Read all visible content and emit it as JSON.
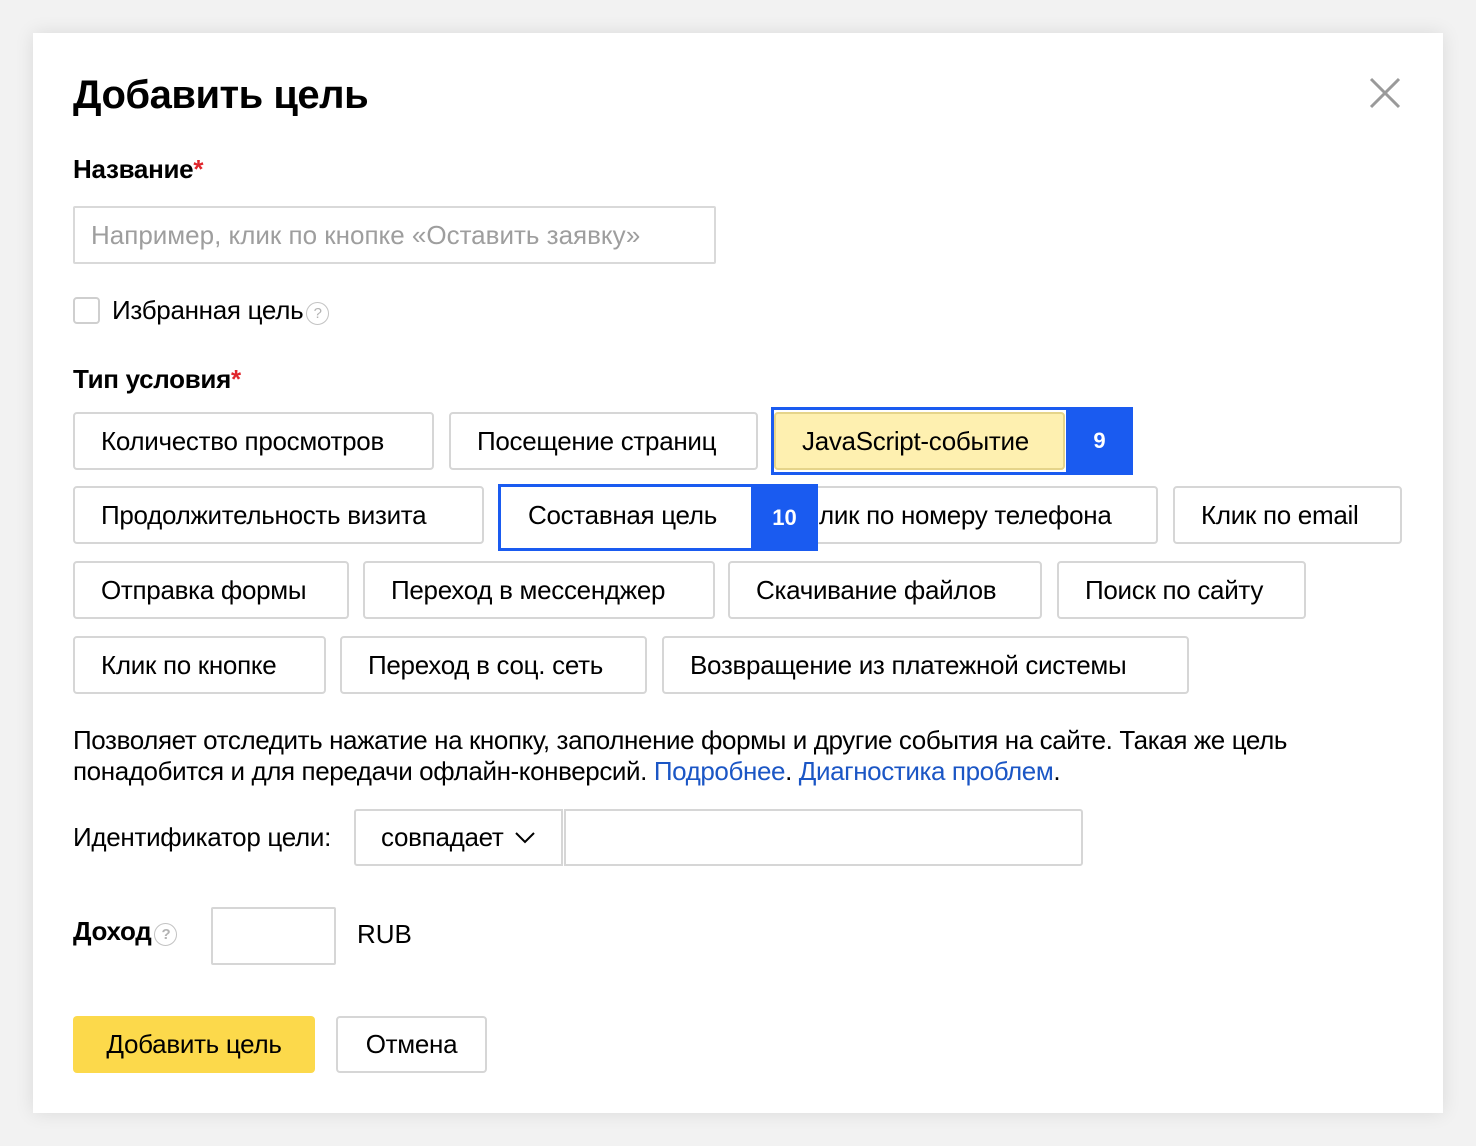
{
  "dialog": {
    "title": "Добавить цель",
    "close_icon": "close-icon"
  },
  "name_field": {
    "label": "Название",
    "required_mark": "*",
    "placeholder": "Например, клик по кнопке «Оставить заявку»",
    "value": ""
  },
  "favorite": {
    "label": "Избранная цель",
    "help_glyph": "?"
  },
  "condition_type": {
    "label": "Тип условия",
    "required_mark": "*",
    "options": [
      "Количество просмотров",
      "Посещение страниц",
      "JavaScript-событие",
      "Продолжительность визита",
      "Составная цель",
      "Клик по номеру телефона",
      "Клик по email",
      "Отправка формы",
      "Переход в мессенджер",
      "Скачивание файлов",
      "Поиск по сайту",
      "Клик по кнопке",
      "Переход в соц. сеть",
      "Возвращение из платежной системы"
    ],
    "visible_label_clik_phone": "лик по номеру телефона",
    "selected": "JavaScript-событие"
  },
  "annotations": [
    {
      "label": "9"
    },
    {
      "label": "10"
    }
  ],
  "description": {
    "text": "Позволяет отследить нажатие на кнопку, заполнение формы и другие события на сайте. Такая же цель понадобится и для передачи офлайн-конверсий. ",
    "link_more": "Подробнее",
    "sep": ". ",
    "link_diag": "Диагностика проблем",
    "end": "."
  },
  "goal_id": {
    "label": "Идентификатор цели:",
    "operator": "совпадает",
    "value": ""
  },
  "income": {
    "label": "Доход",
    "help_glyph": "?",
    "value": "",
    "currency": "RUB"
  },
  "actions": {
    "submit": "Добавить цель",
    "cancel": "Отмена"
  },
  "colors": {
    "accent_yellow": "#fcd94b",
    "selected_bg": "#fef0b0",
    "annotation_blue": "#1a5bf0",
    "link": "#1b56c5",
    "required": "#e0262c"
  }
}
